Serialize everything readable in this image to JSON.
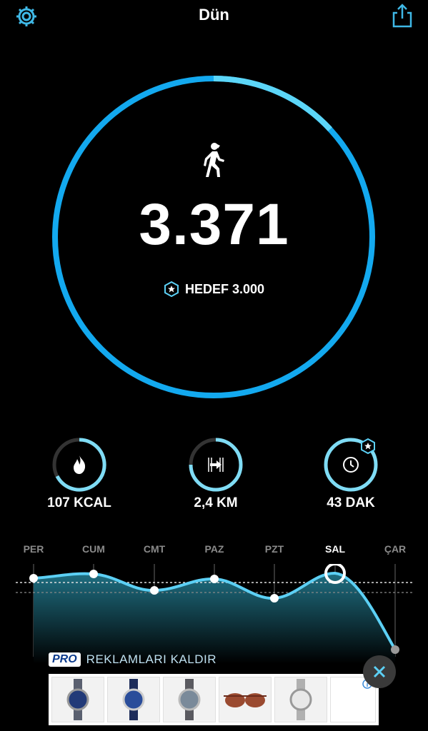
{
  "header": {
    "title": "Dün",
    "settings_icon": "gear-icon",
    "share_icon": "share-icon"
  },
  "main_ring": {
    "icon": "walking-icon",
    "steps": "3.371",
    "goal_label": "HEDEF 3.000",
    "progress_fraction": 1.0,
    "accent": "#1aa3e8",
    "accent_light": "#5cd0f5"
  },
  "stats": [
    {
      "icon": "flame-icon",
      "label": "107 KCAL",
      "fill": 0.72
    },
    {
      "icon": "distance-arrow-icon",
      "label": "2,4 KM",
      "fill": 0.82
    },
    {
      "icon": "clock-icon",
      "label": "43 DAK",
      "fill": 1.0
    }
  ],
  "week_chart": {
    "days": [
      "PER",
      "CUM",
      "CMT",
      "PAZ",
      "PZT",
      "SAL",
      "ÇAR"
    ],
    "active_day": "SAL"
  },
  "ad": {
    "pro_badge": "PRO",
    "remove_ads": "REKLAMLARI KALDIR",
    "info_icon": "info-icon",
    "close_icon": "close-icon"
  }
}
